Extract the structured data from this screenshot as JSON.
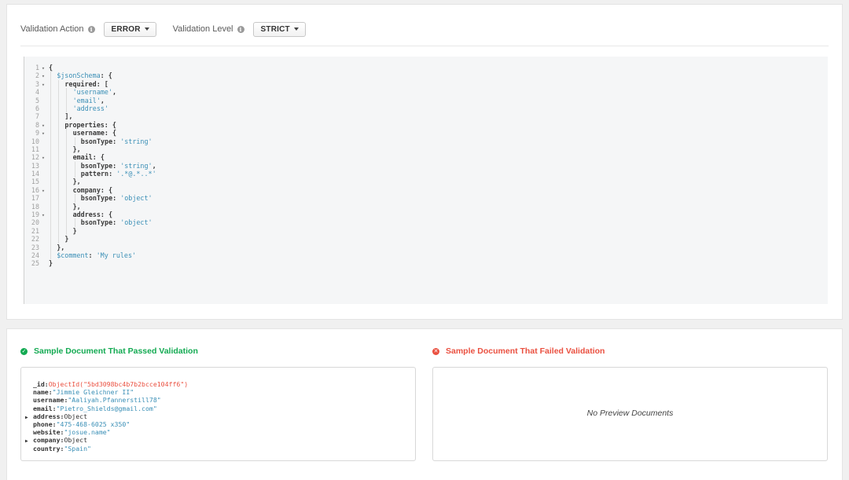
{
  "toolbar": {
    "action_label": "Validation Action",
    "action_value": "ERROR",
    "level_label": "Validation Level",
    "level_value": "STRICT",
    "info_icon_glyph": "i"
  },
  "editor": {
    "lines": [
      {
        "n": "1",
        "fold": true,
        "indent": 0,
        "parts": [
          {
            "t": "{",
            "c": "txt"
          }
        ]
      },
      {
        "n": "2",
        "fold": true,
        "indent": 1,
        "parts": [
          {
            "t": "$jsonSchema",
            "c": "key-blue"
          },
          {
            "t": ": {",
            "c": "txt"
          }
        ]
      },
      {
        "n": "3",
        "fold": true,
        "indent": 2,
        "parts": [
          {
            "t": "required: [",
            "c": "txt"
          }
        ]
      },
      {
        "n": "4",
        "fold": false,
        "indent": 3,
        "parts": [
          {
            "t": "'username'",
            "c": "str"
          },
          {
            "t": ",",
            "c": "txt"
          }
        ]
      },
      {
        "n": "5",
        "fold": false,
        "indent": 3,
        "parts": [
          {
            "t": "'email'",
            "c": "str"
          },
          {
            "t": ",",
            "c": "txt"
          }
        ]
      },
      {
        "n": "6",
        "fold": false,
        "indent": 3,
        "parts": [
          {
            "t": "'address'",
            "c": "str"
          }
        ]
      },
      {
        "n": "7",
        "fold": false,
        "indent": 2,
        "parts": [
          {
            "t": "],",
            "c": "txt"
          }
        ]
      },
      {
        "n": "8",
        "fold": true,
        "indent": 2,
        "parts": [
          {
            "t": "properties: {",
            "c": "txt"
          }
        ]
      },
      {
        "n": "9",
        "fold": true,
        "indent": 3,
        "parts": [
          {
            "t": "username: {",
            "c": "txt"
          }
        ]
      },
      {
        "n": "10",
        "fold": false,
        "indent": 4,
        "parts": [
          {
            "t": "bsonType: ",
            "c": "txt"
          },
          {
            "t": "'string'",
            "c": "str"
          }
        ]
      },
      {
        "n": "11",
        "fold": false,
        "indent": 3,
        "parts": [
          {
            "t": "},",
            "c": "txt"
          }
        ]
      },
      {
        "n": "12",
        "fold": true,
        "indent": 3,
        "parts": [
          {
            "t": "email: {",
            "c": "txt"
          }
        ]
      },
      {
        "n": "13",
        "fold": false,
        "indent": 4,
        "parts": [
          {
            "t": "bsonType: ",
            "c": "txt"
          },
          {
            "t": "'string'",
            "c": "str"
          },
          {
            "t": ",",
            "c": "txt"
          }
        ]
      },
      {
        "n": "14",
        "fold": false,
        "indent": 4,
        "parts": [
          {
            "t": "pattern: ",
            "c": "txt"
          },
          {
            "t": "'.*@.*..*'",
            "c": "str"
          }
        ]
      },
      {
        "n": "15",
        "fold": false,
        "indent": 3,
        "parts": [
          {
            "t": "},",
            "c": "txt"
          }
        ]
      },
      {
        "n": "16",
        "fold": true,
        "indent": 3,
        "parts": [
          {
            "t": "company: {",
            "c": "txt"
          }
        ]
      },
      {
        "n": "17",
        "fold": false,
        "indent": 4,
        "parts": [
          {
            "t": "bsonType: ",
            "c": "txt"
          },
          {
            "t": "'object'",
            "c": "str"
          }
        ]
      },
      {
        "n": "18",
        "fold": false,
        "indent": 3,
        "parts": [
          {
            "t": "},",
            "c": "txt"
          }
        ]
      },
      {
        "n": "19",
        "fold": true,
        "indent": 3,
        "parts": [
          {
            "t": "address: {",
            "c": "txt"
          }
        ]
      },
      {
        "n": "20",
        "fold": false,
        "indent": 4,
        "parts": [
          {
            "t": "bsonType: ",
            "c": "txt"
          },
          {
            "t": "'object'",
            "c": "str"
          }
        ]
      },
      {
        "n": "21",
        "fold": false,
        "indent": 3,
        "parts": [
          {
            "t": "}",
            "c": "txt"
          }
        ]
      },
      {
        "n": "22",
        "fold": false,
        "indent": 2,
        "parts": [
          {
            "t": "}",
            "c": "txt"
          }
        ]
      },
      {
        "n": "23",
        "fold": false,
        "indent": 1,
        "parts": [
          {
            "t": "},",
            "c": "txt"
          }
        ]
      },
      {
        "n": "24",
        "fold": false,
        "indent": 1,
        "parts": [
          {
            "t": "$comment",
            "c": "key-blue"
          },
          {
            "t": ": ",
            "c": "txt"
          },
          {
            "t": "'My rules'",
            "c": "str"
          }
        ]
      },
      {
        "n": "25",
        "fold": false,
        "indent": 0,
        "parts": [
          {
            "t": "}",
            "c": "txt"
          }
        ]
      }
    ]
  },
  "passed": {
    "title": "Sample Document That Passed Validation",
    "icon_glyph": "✓",
    "fields": [
      {
        "key": "_id",
        "value": "ObjectId(\"5bd3098bc4b7b2bcce104ff6\")",
        "kind": "oid",
        "expandable": false
      },
      {
        "key": "name",
        "value": "\"Jimmie Gleichner II\"",
        "kind": "str",
        "expandable": false
      },
      {
        "key": "username",
        "value": "\"Aaliyah.Pfannerstill78\"",
        "kind": "str",
        "expandable": false
      },
      {
        "key": "email",
        "value": "\"Pietro_Shields@gmail.com\"",
        "kind": "str",
        "expandable": false
      },
      {
        "key": "address",
        "value": "Object",
        "kind": "obj",
        "expandable": true
      },
      {
        "key": "phone",
        "value": "\"475-468-6025 x350\"",
        "kind": "str",
        "expandable": false
      },
      {
        "key": "website",
        "value": "\"josue.name\"",
        "kind": "str",
        "expandable": false
      },
      {
        "key": "company",
        "value": "Object",
        "kind": "obj",
        "expandable": true
      },
      {
        "key": "country",
        "value": "\"Spain\"",
        "kind": "str",
        "expandable": false
      }
    ]
  },
  "failed": {
    "title": "Sample Document That Failed Validation",
    "icon_glyph": "✕",
    "empty_message": "No Preview Documents"
  },
  "colors": {
    "pass": "#13aa52",
    "fail": "#ea5040",
    "string": "#3a8fb6"
  }
}
